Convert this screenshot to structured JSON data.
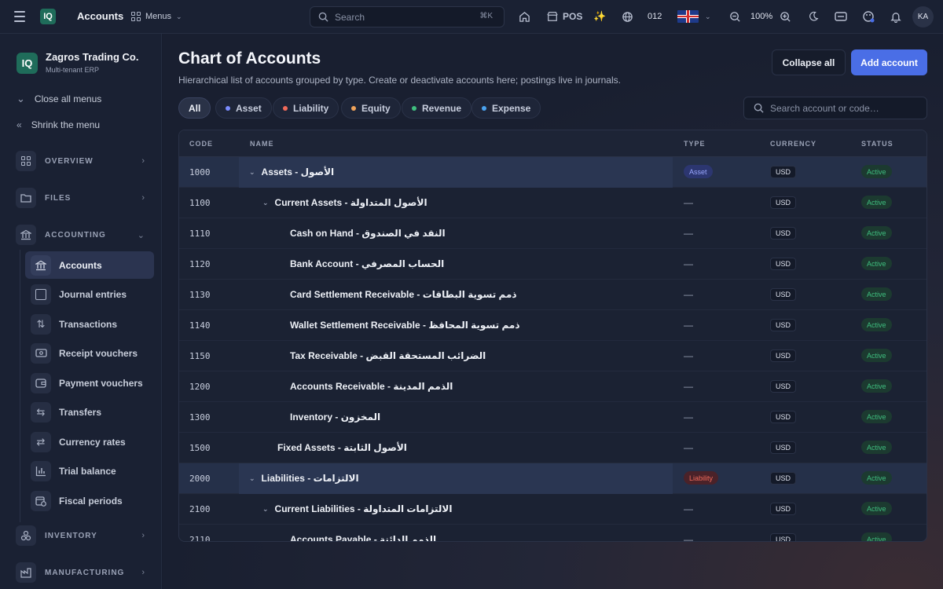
{
  "topbar": {
    "app_title": "Accounts",
    "menus_label": "Menus",
    "search_placeholder": "Search",
    "search_shortcut": "⌘K",
    "pos_label": "POS",
    "branch_code": "012",
    "zoom_level": "100%",
    "avatar_initials": "KA"
  },
  "sidebar": {
    "company_name": "Zagros Trading Co.",
    "company_sub": "Multi-tenant ERP",
    "close_all": "Close all menus",
    "shrink": "Shrink the menu",
    "sections": {
      "overview": "OVERVIEW",
      "files": "FILES",
      "accounting": "ACCOUNTING",
      "inventory": "INVENTORY",
      "manufacturing": "MANUFACTURING"
    },
    "accounting_items": [
      {
        "label": "Accounts",
        "icon": "bank-icon"
      },
      {
        "label": "Journal entries",
        "icon": "journal-icon"
      },
      {
        "label": "Transactions",
        "icon": "sort-arrows-icon"
      },
      {
        "label": "Receipt vouchers",
        "icon": "banknote-icon"
      },
      {
        "label": "Payment vouchers",
        "icon": "wallet-icon"
      },
      {
        "label": "Transfers",
        "icon": "transfer-icon"
      },
      {
        "label": "Currency rates",
        "icon": "exchange-icon"
      },
      {
        "label": "Trial balance",
        "icon": "bar-chart-icon"
      },
      {
        "label": "Fiscal periods",
        "icon": "calendar-clock-icon"
      }
    ]
  },
  "page": {
    "title": "Chart of Accounts",
    "subtitle": "Hierarchical list of accounts grouped by type. Create or deactivate accounts here; postings live in journals.",
    "collapse_all": "Collapse all",
    "add_account": "Add account",
    "account_search_placeholder": "Search account or code…"
  },
  "filters": [
    {
      "label": "All",
      "color": ""
    },
    {
      "label": "Asset",
      "color": "#7b8cff"
    },
    {
      "label": "Liability",
      "color": "#f06a5a"
    },
    {
      "label": "Equity",
      "color": "#f0a35a"
    },
    {
      "label": "Revenue",
      "color": "#3fbf7f"
    },
    {
      "label": "Expense",
      "color": "#4aa3f0"
    }
  ],
  "table": {
    "headers": {
      "code": "CODE",
      "name": "NAME",
      "type": "TYPE",
      "currency": "CURRENCY",
      "status": "STATUS"
    },
    "rows": [
      {
        "code": "1000",
        "name": "Assets - الأصول",
        "type": "Asset",
        "currency": "USD",
        "status": "Active"
      },
      {
        "code": "1100",
        "name": "Current Assets - الأصول المتداولة",
        "type": "—",
        "currency": "USD",
        "status": "Active"
      },
      {
        "code": "1110",
        "name": "Cash on Hand - النقد في الصندوق",
        "type": "—",
        "currency": "USD",
        "status": "Active"
      },
      {
        "code": "1120",
        "name": "Bank Account - الحساب المصرفي",
        "type": "—",
        "currency": "USD",
        "status": "Active"
      },
      {
        "code": "1130",
        "name": "Card Settlement Receivable - ذمم تسوية البطاقات",
        "type": "—",
        "currency": "USD",
        "status": "Active"
      },
      {
        "code": "1140",
        "name": "Wallet Settlement Receivable - ذمم تسوية المحافظ",
        "type": "—",
        "currency": "USD",
        "status": "Active"
      },
      {
        "code": "1150",
        "name": "Tax Receivable - الضرائب المستحقة القبض",
        "type": "—",
        "currency": "USD",
        "status": "Active"
      },
      {
        "code": "1200",
        "name": "Accounts Receivable - الذمم المدينة",
        "type": "—",
        "currency": "USD",
        "status": "Active"
      },
      {
        "code": "1300",
        "name": "Inventory - المخزون",
        "type": "—",
        "currency": "USD",
        "status": "Active"
      },
      {
        "code": "1500",
        "name": "Fixed Assets - الأصول الثابتة",
        "type": "—",
        "currency": "USD",
        "status": "Active"
      },
      {
        "code": "2000",
        "name": "Liabilities - الالتزامات",
        "type": "Liability",
        "currency": "USD",
        "status": "Active"
      },
      {
        "code": "2100",
        "name": "Current Liabilities - الالتزامات المتداولة",
        "type": "—",
        "currency": "USD",
        "status": "Active"
      },
      {
        "code": "2110",
        "name": "Accounts Payable - الذمم الدائنة",
        "type": "—",
        "currency": "USD",
        "status": "Active"
      }
    ]
  }
}
